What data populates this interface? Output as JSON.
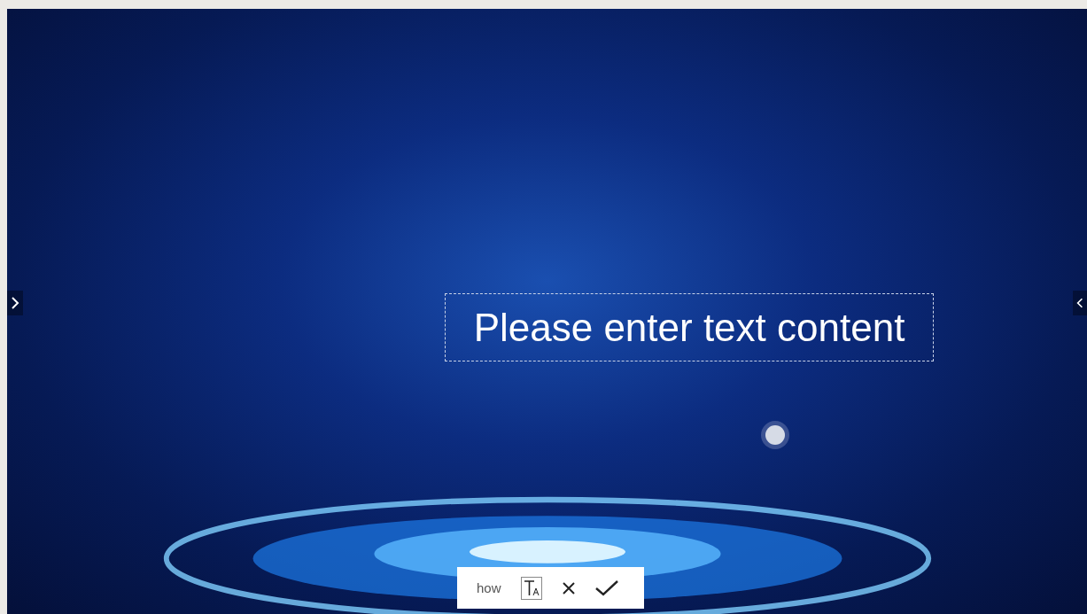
{
  "text_box": {
    "text": "Please enter text content"
  },
  "toolbar": {
    "label": "how"
  }
}
